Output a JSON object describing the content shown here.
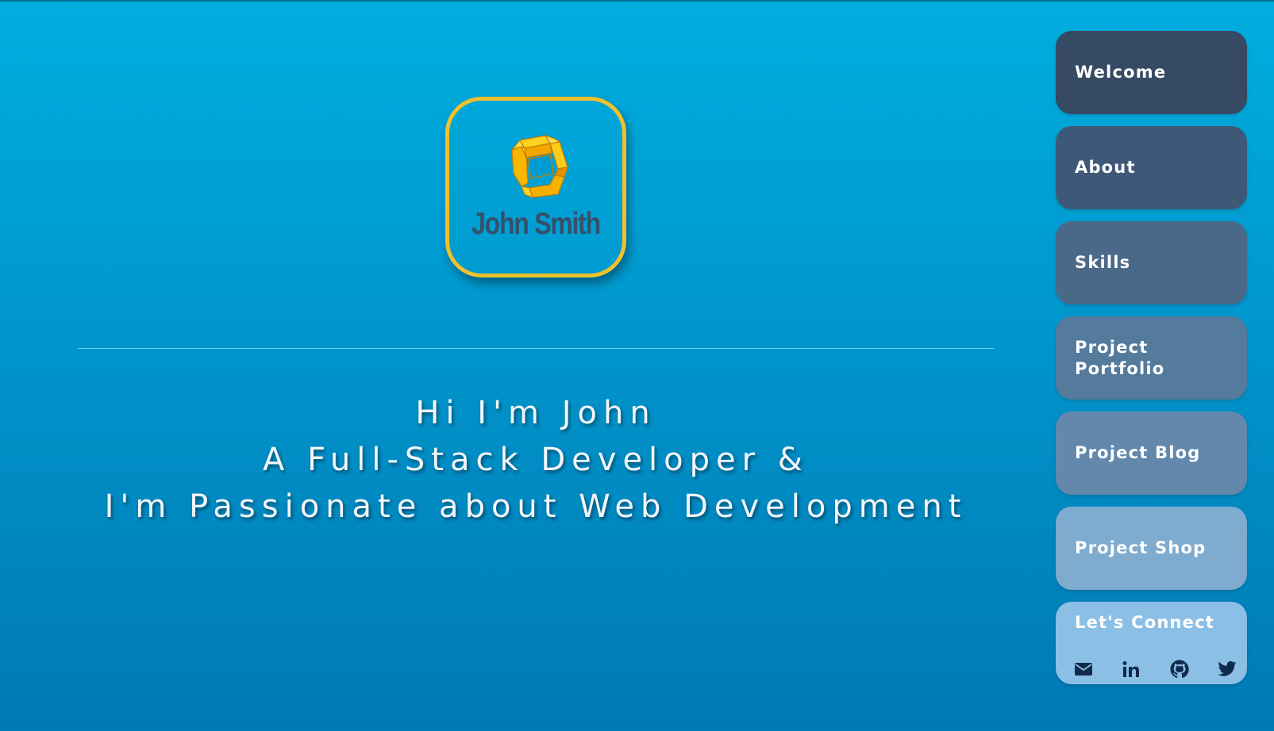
{
  "logo": {
    "name": "John Smith",
    "icon": "gold-square-knot-logo",
    "border_color": "#f1c12b",
    "mark_color": "#f4b300"
  },
  "hero": {
    "lines": [
      "Hi I'm John",
      "A Full-Stack Developer &",
      "I'm Passionate about Web Development"
    ]
  },
  "nav": {
    "items": [
      {
        "label": "Welcome",
        "color": "#364a63"
      },
      {
        "label": "About",
        "color": "#3e5978"
      },
      {
        "label": "Skills",
        "color": "#4a6989"
      },
      {
        "label": "Project Portfolio",
        "color": "#547a9c"
      },
      {
        "label": "Project Blog",
        "color": "#6388ac"
      },
      {
        "label": "Project Shop",
        "color": "#7fabcf"
      }
    ],
    "connect": {
      "label": "Let's Connect",
      "color": "#8cbfe6",
      "icons": [
        "envelope-icon",
        "linkedin-icon",
        "github-icon",
        "twitter-icon"
      ],
      "icon_color": "#102a4c"
    }
  },
  "colors": {
    "background_top": "#00aedf",
    "background_bottom": "#0079b3",
    "text": "#f2f6fa"
  }
}
